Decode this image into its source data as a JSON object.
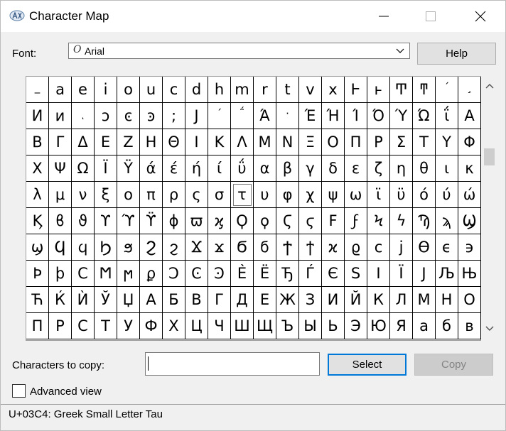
{
  "window": {
    "title": "Character Map",
    "app_icon": "character-map-icon",
    "controls": [
      "minimize-icon",
      "maximize-icon",
      "close-icon"
    ]
  },
  "font": {
    "label": "Font:",
    "value": "Arial",
    "type_glyph": "O",
    "help_label": "Help"
  },
  "grid": {
    "rows": [
      [
        "_",
        "a",
        "e",
        "i",
        "o",
        "u",
        "c",
        "d",
        "h",
        "m",
        "r",
        "t",
        "v",
        "x",
        "Ͱ",
        "ͱ",
        "Ͳ",
        "ͳ",
        "´",
        "¸"
      ],
      [
        "Ͷ",
        "ͷ",
        "ͺ",
        "ͻ",
        "ͼ",
        "ͽ",
        ";",
        "Ϳ",
        "΄",
        "΅",
        "Ά",
        "·",
        "Έ",
        "Ή",
        "Ί",
        "Ό",
        "Ύ",
        "Ώ",
        "ΐ",
        "Α"
      ],
      [
        "Β",
        "Γ",
        "Δ",
        "Ε",
        "Ζ",
        "Η",
        "Θ",
        "Ι",
        "Κ",
        "Λ",
        "Μ",
        "Ν",
        "Ξ",
        "Ο",
        "Π",
        "Ρ",
        "Σ",
        "Τ",
        "Υ",
        "Φ"
      ],
      [
        "Χ",
        "Ψ",
        "Ω",
        "Ϊ",
        "Ϋ",
        "ά",
        "έ",
        "ή",
        "ί",
        "ΰ",
        "α",
        "β",
        "γ",
        "δ",
        "ε",
        "ζ",
        "η",
        "θ",
        "ι",
        "κ"
      ],
      [
        "λ",
        "μ",
        "ν",
        "ξ",
        "ο",
        "π",
        "ρ",
        "ς",
        "σ",
        "τ",
        "υ",
        "φ",
        "χ",
        "ψ",
        "ω",
        "ϊ",
        "ϋ",
        "ό",
        "ύ",
        "ώ"
      ],
      [
        "Ϗ",
        "ϐ",
        "ϑ",
        "ϒ",
        "ϓ",
        "ϔ",
        "ϕ",
        "ϖ",
        "ϗ",
        "Ϙ",
        "ϙ",
        "Ϛ",
        "ϛ",
        "Ϝ",
        "ϝ",
        "Ϟ",
        "ϟ",
        "Ϡ",
        "ϡ",
        "Ϣ"
      ],
      [
        "ϣ",
        "Ϥ",
        "ϥ",
        "Ϧ",
        "ϧ",
        "Ϩ",
        "ϩ",
        "Ϫ",
        "ϫ",
        "Ϭ",
        "ϭ",
        "Ϯ",
        "ϯ",
        "ϰ",
        "ϱ",
        "ϲ",
        "ϳ",
        "ϴ",
        "ϵ",
        "϶"
      ],
      [
        "Ϸ",
        "ϸ",
        "Ϲ",
        "Ϻ",
        "ϻ",
        "ϼ",
        "Ͻ",
        "Ͼ",
        "Ͽ",
        "Ѐ",
        "Ё",
        "Ђ",
        "Ѓ",
        "Є",
        "Ѕ",
        "І",
        "Ї",
        "Ј",
        "Љ",
        "Њ"
      ],
      [
        "Ћ",
        "Ќ",
        "Ѝ",
        "Ў",
        "Џ",
        "А",
        "Б",
        "В",
        "Г",
        "Д",
        "Е",
        "Ж",
        "З",
        "И",
        "Й",
        "К",
        "Л",
        "М",
        "Н",
        "О"
      ],
      [
        "П",
        "Р",
        "С",
        "Т",
        "У",
        "Ф",
        "Х",
        "Ц",
        "Ч",
        "Ш",
        "Щ",
        "Ъ",
        "Ы",
        "Ь",
        "Э",
        "Ю",
        "Я",
        "а",
        "б",
        "в"
      ]
    ],
    "selected": "τ"
  },
  "scrollbar": {
    "up_icon": "chevron-up-icon",
    "down_icon": "chevron-down-icon"
  },
  "copy": {
    "label": "Characters to copy:",
    "value": "",
    "select_label": "Select",
    "copy_label": "Copy"
  },
  "advanced": {
    "label": "Advanced view",
    "checked": false
  },
  "status": {
    "text": "U+03C4: Greek Small Letter Tau"
  }
}
